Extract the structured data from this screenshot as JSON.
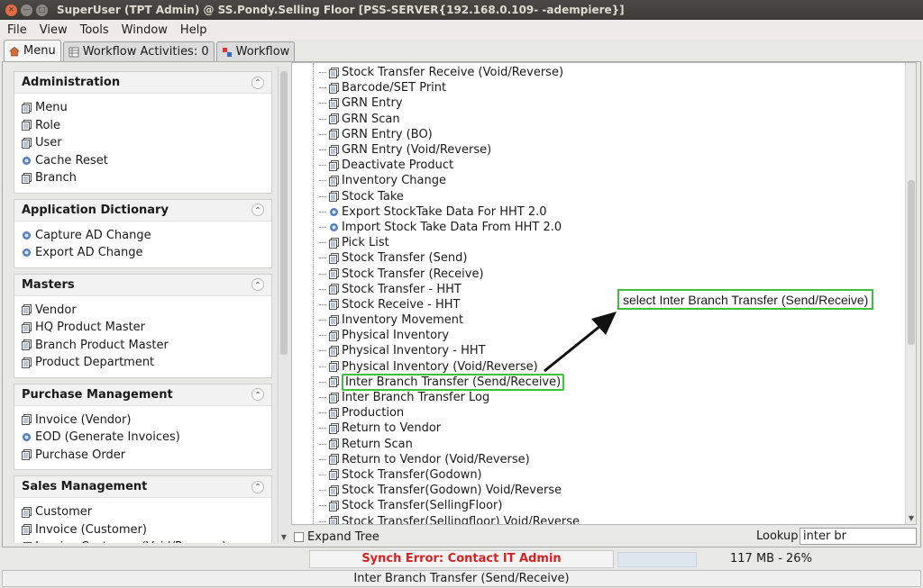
{
  "window": {
    "title": "SuperUser (TPT Admin) @ SS.Pondy.Selling Floor [PSS-SERVER{192.168.0.109-             -adempiere}]"
  },
  "menubar": [
    "File",
    "View",
    "Tools",
    "Window",
    "Help"
  ],
  "tabs": [
    {
      "label": "Menu",
      "icon": "home-icon"
    },
    {
      "label": "Workflow Activities: 0",
      "icon": "table-icon"
    },
    {
      "label": "Workflow",
      "icon": "workflow-icon"
    }
  ],
  "sections": [
    {
      "title": "Administration",
      "items": [
        {
          "label": "Menu",
          "icon": "doc"
        },
        {
          "label": "Role",
          "icon": "doc"
        },
        {
          "label": "User",
          "icon": "doc"
        },
        {
          "label": "Cache Reset",
          "icon": "gear"
        },
        {
          "label": "Branch",
          "icon": "doc"
        }
      ]
    },
    {
      "title": "Application Dictionary",
      "items": [
        {
          "label": "Capture AD Change",
          "icon": "gear"
        },
        {
          "label": "Export AD Change",
          "icon": "gear"
        }
      ]
    },
    {
      "title": "Masters",
      "items": [
        {
          "label": "Vendor",
          "icon": "doc"
        },
        {
          "label": "HQ Product Master",
          "icon": "doc"
        },
        {
          "label": "Branch Product Master",
          "icon": "doc"
        },
        {
          "label": "Product Department",
          "icon": "doc"
        }
      ]
    },
    {
      "title": "Purchase Management",
      "items": [
        {
          "label": "Invoice (Vendor)",
          "icon": "doc"
        },
        {
          "label": "EOD (Generate Invoices)",
          "icon": "gear"
        },
        {
          "label": "Purchase Order",
          "icon": "doc"
        }
      ]
    },
    {
      "title": "Sales Management",
      "items": [
        {
          "label": "Customer",
          "icon": "doc"
        },
        {
          "label": "Invoice (Customer)",
          "icon": "doc"
        },
        {
          "label": "Invoice Customer (Void/Reverse)",
          "icon": "doc"
        }
      ]
    }
  ],
  "tree": [
    {
      "label": "Stock Transfer Receive (Void/Reverse)",
      "icon": "doc"
    },
    {
      "label": "Barcode/SET Print",
      "icon": "doc"
    },
    {
      "label": "GRN Entry",
      "icon": "doc"
    },
    {
      "label": "GRN Scan",
      "icon": "doc"
    },
    {
      "label": "GRN Entry (BO)",
      "icon": "doc"
    },
    {
      "label": "GRN Entry (Void/Reverse)",
      "icon": "doc"
    },
    {
      "label": "Deactivate Product",
      "icon": "doc"
    },
    {
      "label": "Inventory Change",
      "icon": "doc"
    },
    {
      "label": "Stock Take",
      "icon": "doc"
    },
    {
      "label": "Export StockTake Data For HHT 2.0",
      "icon": "gear"
    },
    {
      "label": "Import Stock Take Data From HHT 2.0",
      "icon": "gear"
    },
    {
      "label": "Pick List",
      "icon": "doc"
    },
    {
      "label": "Stock Transfer (Send)",
      "icon": "doc"
    },
    {
      "label": "Stock Transfer (Receive)",
      "icon": "doc"
    },
    {
      "label": "Stock Transfer - HHT",
      "icon": "doc"
    },
    {
      "label": "Stock Receive - HHT",
      "icon": "doc"
    },
    {
      "label": "Inventory Movement",
      "icon": "doc"
    },
    {
      "label": "Physical Inventory",
      "icon": "doc"
    },
    {
      "label": "Physical Inventory - HHT",
      "icon": "doc"
    },
    {
      "label": "Physical Inventory (Void/Reverse)",
      "icon": "doc"
    },
    {
      "label": "Inter Branch Transfer (Send/Receive)",
      "icon": "doc",
      "highlighted": true
    },
    {
      "label": "Inter Branch Transfer Log",
      "icon": "doc"
    },
    {
      "label": "Production",
      "icon": "doc"
    },
    {
      "label": "Return to Vendor",
      "icon": "doc"
    },
    {
      "label": "Return Scan",
      "icon": "doc"
    },
    {
      "label": "Return to Vendor (Void/Reverse)",
      "icon": "doc"
    },
    {
      "label": "Stock Transfer(Godown)",
      "icon": "doc"
    },
    {
      "label": "Stock Transfer(Godown) Void/Reverse",
      "icon": "doc"
    },
    {
      "label": "Stock Transfer(SellingFloor)",
      "icon": "doc"
    },
    {
      "label": "Stock Transfer(Sellingfloor) Void/Reverse",
      "icon": "doc"
    }
  ],
  "tree_footer": {
    "expand_label": "Expand Tree",
    "lookup_label": "Lookup",
    "lookup_value": "inter br"
  },
  "annotation": "select Inter Branch Transfer (Send/Receive)",
  "status": {
    "synch": "Synch Error: Contact IT Admin",
    "memory": "117 MB - 26%",
    "message": "Inter Branch Transfer (Send/Receive)"
  },
  "colors": {
    "highlight": "#3ec23e",
    "error": "#d92020"
  }
}
